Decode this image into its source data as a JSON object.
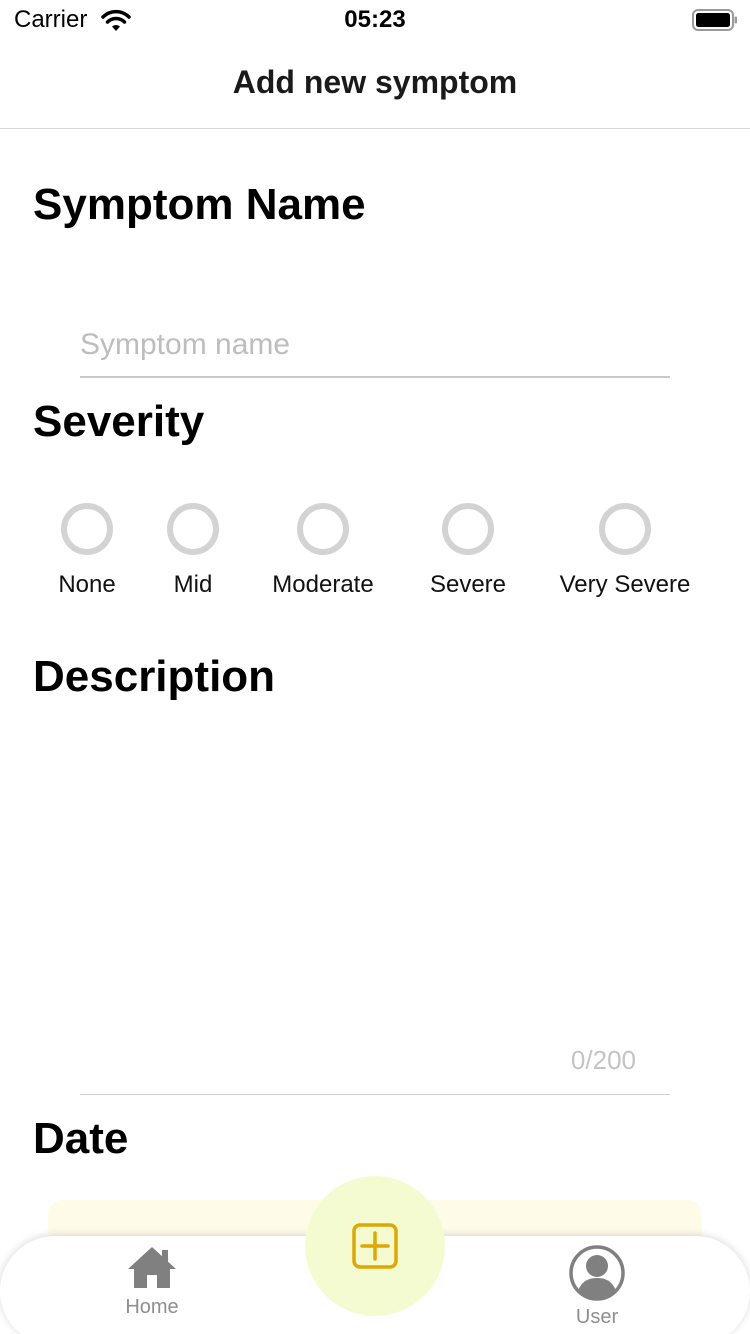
{
  "status_bar": {
    "carrier": "Carrier",
    "time": "05:23"
  },
  "nav": {
    "title": "Add new symptom"
  },
  "symptom_name": {
    "title": "Symptom Name",
    "placeholder": "Symptom name",
    "value": ""
  },
  "severity": {
    "title": "Severity",
    "options": [
      "None",
      "Mid",
      "Moderate",
      "Severe",
      "Very Severe"
    ],
    "selected": null
  },
  "description": {
    "title": "Description",
    "counter": "0/200"
  },
  "date": {
    "title": "Date"
  },
  "tab_bar": {
    "home_label": "Home",
    "user_label": "User",
    "accent_color": "#e0a700",
    "fab_background": "#f5fbd1",
    "icons": {
      "home": "home-icon",
      "add": "add-square-icon",
      "user": "user-circle-icon"
    }
  }
}
